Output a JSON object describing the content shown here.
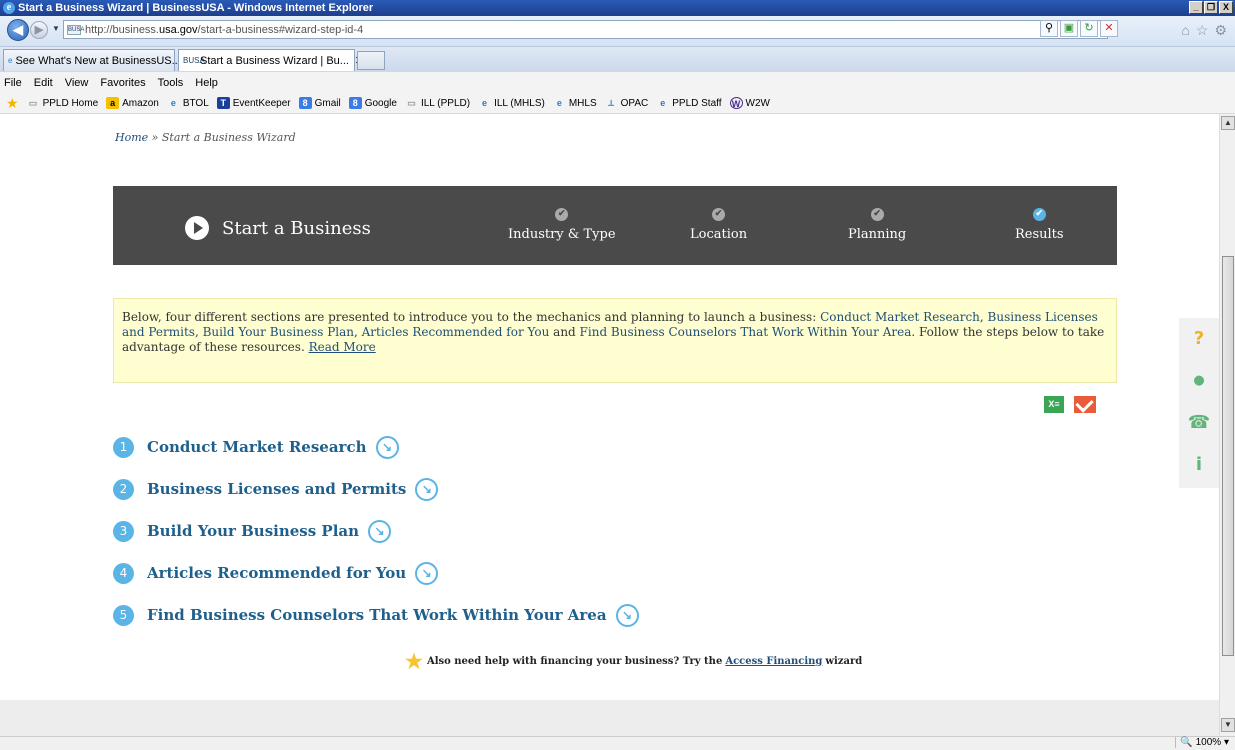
{
  "window": {
    "title": "Start a Business Wizard | BusinessUSA - Windows Internet Explorer",
    "controls": [
      "_",
      "Ř",
      "X"
    ]
  },
  "address": {
    "url_prefix": "http://business.",
    "url_domain": "usa.gov",
    "url_suffix": "/start-a-business#wizard-step-id-4",
    "favicon": "BUSA"
  },
  "tabs": [
    {
      "label": "See What's New at BusinessUS..."
    },
    {
      "label": "Start a Business Wizard | Bu..."
    }
  ],
  "menu": {
    "items": [
      "File",
      "Edit",
      "View",
      "Favorites",
      "Tools",
      "Help"
    ]
  },
  "favorites": {
    "items": [
      {
        "label": "PPLD Home",
        "icon": "folder-icon"
      },
      {
        "label": "Amazon",
        "icon": "amazon-icon"
      },
      {
        "label": "BTOL",
        "icon": "ie-icon"
      },
      {
        "label": "EventKeeper",
        "icon": "eventkeeper-icon"
      },
      {
        "label": "Gmail",
        "icon": "google-icon"
      },
      {
        "label": "Google",
        "icon": "google-icon"
      },
      {
        "label": "ILL (PPLD)",
        "icon": "folder-icon"
      },
      {
        "label": "ILL (MHLS)",
        "icon": "ie-icon"
      },
      {
        "label": "MHLS",
        "icon": "ie-icon"
      },
      {
        "label": "OPAC",
        "icon": "opac-icon"
      },
      {
        "label": "PPLD Staff",
        "icon": "ie-icon"
      },
      {
        "label": "W2W",
        "icon": "w2w-icon"
      }
    ]
  },
  "breadcrumb": {
    "home": "Home",
    "separator": " » ",
    "current": "Start a Business Wizard"
  },
  "wizard": {
    "title": "Start a Business",
    "steps": [
      {
        "label": "Industry & Type",
        "done": false
      },
      {
        "label": "Location",
        "done": false
      },
      {
        "label": "Planning",
        "done": false
      },
      {
        "label": "Results",
        "done": true
      }
    ]
  },
  "intro": {
    "text1": "Below, four different sections are presented to introduce you to the mechanics and planning to launch a business: ",
    "link1": "Conduct Market Research",
    "sep1": ", ",
    "link2": "Business Licenses and Permits",
    "sep2": ", ",
    "link3": "Build Your Business Plan",
    "sep3": ", ",
    "link4": "Articles Recommended for You",
    "sep4": " and ",
    "link5": "Find Business Counselors That Work Within Your Area",
    "text2": ". Follow the steps below to take advantage of these resources. ",
    "read_more": "Read More"
  },
  "share": {
    "xls_label": "X≡"
  },
  "sections": [
    {
      "num": "1",
      "title": "Conduct Market Research"
    },
    {
      "num": "2",
      "title": "Business Licenses and Permits"
    },
    {
      "num": "3",
      "title": "Build Your Business Plan"
    },
    {
      "num": "4",
      "title": "Articles Recommended for You"
    },
    {
      "num": "5",
      "title": "Find Business Counselors That Work Within Your Area"
    }
  ],
  "financing": {
    "prefix": "Also need help with financing your business? Try the",
    "link": "Access Financing",
    "suffix": "wizard"
  },
  "side_tools": [
    "?",
    "●",
    "☎",
    "i"
  ],
  "status": {
    "zoom": "100%"
  }
}
